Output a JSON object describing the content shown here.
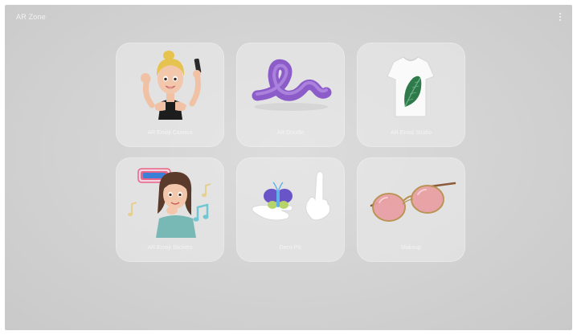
{
  "app": {
    "title": "AR Zone"
  },
  "header": {
    "menu_icon": "more-vertical-icon"
  },
  "tiles": [
    {
      "label": "AR Emoji Camera",
      "icon": "emoji-selfie-icon"
    },
    {
      "label": "AR Doodle",
      "icon": "doodle-squiggle-icon"
    },
    {
      "label": "AR Emoji Studio",
      "icon": "tshirt-leaf-icon"
    },
    {
      "label": "AR Emoji Stickers",
      "icon": "emoji-on-air-icon"
    },
    {
      "label": "Deco Pic",
      "icon": "hand-butterfly-icon"
    },
    {
      "label": "Makeup",
      "icon": "sunglasses-icon"
    }
  ],
  "colors": {
    "background": "#d2d2d2",
    "tile": "#e6e6e6",
    "doodle": "#9b6fd0",
    "on_air_sign": "#e8648a",
    "lens": "#e8a0a4"
  }
}
